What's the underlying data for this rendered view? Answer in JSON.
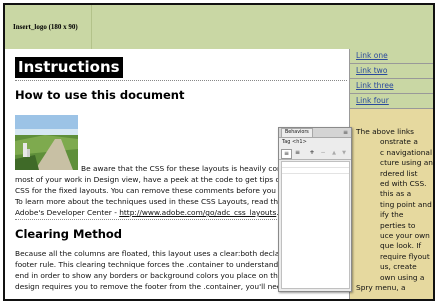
{
  "logo": {
    "text": "Insert_logo (180 x 90)"
  },
  "content": {
    "title": "Instructions",
    "section1": {
      "heading": "How to use this document",
      "lines": [
        "Be aware that the CSS for these layouts is heavily comm",
        "most of your work in Design view, have a peek at the code to get tips on",
        "CSS for the fixed layouts. You can remove these comments before you la",
        "To learn more about the techniques used in these CSS Layouts, read this"
      ],
      "last_line_prefix": "Adobe's Developer Center - ",
      "link": "http://www.adobe.com/go/adc_css_layouts",
      "last_line_suffix": "."
    },
    "section2": {
      "heading": "Clearing Method",
      "lines": [
        "Because all the columns are floated, this layout uses a clear:both declara",
        "footer rule. This clearing technique forces the .container to understand w",
        "end in order to show any borders or background colors you place on the .",
        "design requires you to remove the footer from the .container, you'll need to use a"
      ]
    }
  },
  "sidebar": {
    "links": [
      "Link one",
      "Link two",
      "Link three",
      "Link four"
    ],
    "text_lines": [
      "The above links",
      "onstrate a",
      "c navigational",
      "cture using an",
      "rdered list",
      "ed with CSS.",
      "this as a",
      "ting point and",
      "ify the",
      "perties to",
      "uce your own",
      "que look. If",
      "require flyout",
      "us, create",
      "own using a",
      "Spry menu, a"
    ]
  },
  "behaviors_panel": {
    "tab": "Behaviors",
    "tag_label": "Tag <h1>",
    "menu_icon": "panel-menu-icon",
    "tools": [
      "show-set-events-icon",
      "show-all-events-icon",
      "add-behavior-icon",
      "remove-behavior-icon",
      "move-up-icon",
      "move-down-icon"
    ],
    "tool_glyphs": [
      "≡",
      "≡",
      "+",
      "−",
      "▲",
      "▼"
    ]
  },
  "colors": {
    "frame_bg": "#c9d7a4",
    "sidebar_bg": "#e6d99f",
    "link": "#2a4a9c"
  }
}
